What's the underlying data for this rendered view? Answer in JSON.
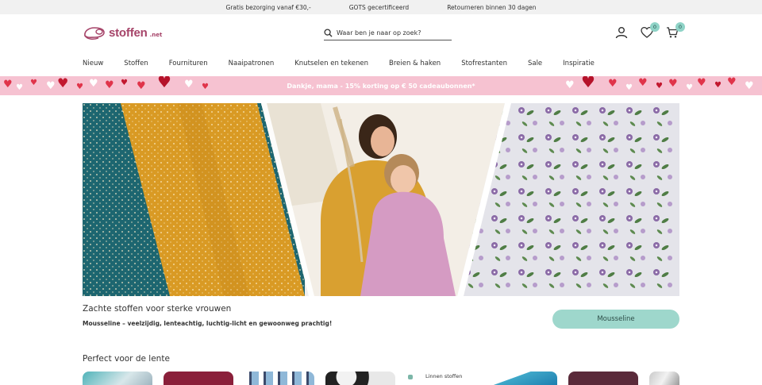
{
  "topbar": {
    "items": [
      "Gratis bezorging vanaf €30,-",
      "GOTS gecertificeerd",
      "Retourneren binnen 30 dagen"
    ]
  },
  "header": {
    "logo_text": "stoffen",
    "logo_suffix": ".net",
    "search_placeholder": "Waar ben je naar op zoek?",
    "wishlist_count": "0",
    "cart_count": "0"
  },
  "nav": {
    "items": [
      "Nieuw",
      "Stoffen",
      "Fournituren",
      "Naaipatronen",
      "Knutselen en tekenen",
      "Breien & haken",
      "Stofrestanten",
      "Sale",
      "Inspiratie"
    ]
  },
  "promo": {
    "text": "Dankje, mama - 15% korting op € 50 cadeaubonnen*"
  },
  "hero": {
    "title": "Zachte stoffen voor sterke vrouwen",
    "subtitle": "Mousseline – veelzijdig, lenteachtig, luchtig-licht en gewoonweg prachtig!",
    "button_label": "Mousseline"
  },
  "spring": {
    "title": "Perfect voor de lente",
    "tile_label": "Linnen stoffen"
  },
  "colors": {
    "brand": "#a64469",
    "accent": "#9ed7cc",
    "promo_bg": "#f6c2d1"
  }
}
